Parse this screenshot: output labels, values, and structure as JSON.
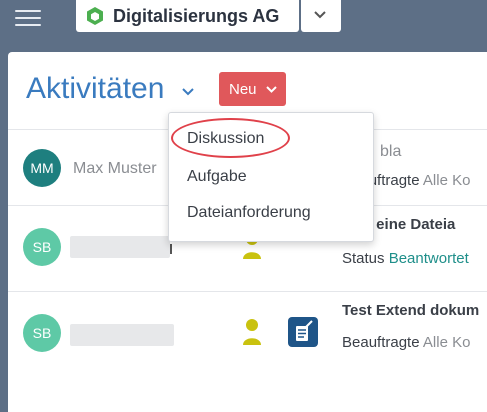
{
  "header": {
    "org_name": "Digitalisierungs AG",
    "menu_icon": "hamburger-icon",
    "logo_icon": "hexagon-logo-icon",
    "org_switch_icon": "chevron-down-icon"
  },
  "main": {
    "title": "Aktivitäten",
    "new_button_label": "Neu"
  },
  "dropdown": {
    "items": [
      "Diskussion",
      "Aufgabe",
      "Dateianforderung"
    ],
    "highlighted_item": "Diskussion"
  },
  "rows": [
    {
      "avatar": "MM",
      "name": "Max Muster",
      "snippet": "bla",
      "line2_label": "Beauftragte",
      "line2_value": "Alle Ko"
    },
    {
      "avatar": "SB",
      "title": "s ist eine Dateia",
      "line2_label": "Status",
      "line2_value": "Beantwortet",
      "person_icon": "person-icon"
    },
    {
      "avatar": "SB",
      "title": "Test Extend dokum",
      "line2_label": "Beauftragte",
      "line2_value": "Alle Ko",
      "person_icon": "person-icon",
      "doc_icon": "document-edit-icon"
    }
  ],
  "colors": {
    "header_bg": "#5d6f86",
    "accent_blue": "#3a7bbf",
    "new_button": "#e0585b",
    "highlight_ring": "#e0414a",
    "logo_green": "#4caf50",
    "avatar_mm": "#1e7f7f",
    "avatar_sb": "#5ec9a6",
    "person_icon": "#c9c20f",
    "doc_icon_bg": "#1f5588",
    "status_teal": "#1f8f8a"
  }
}
